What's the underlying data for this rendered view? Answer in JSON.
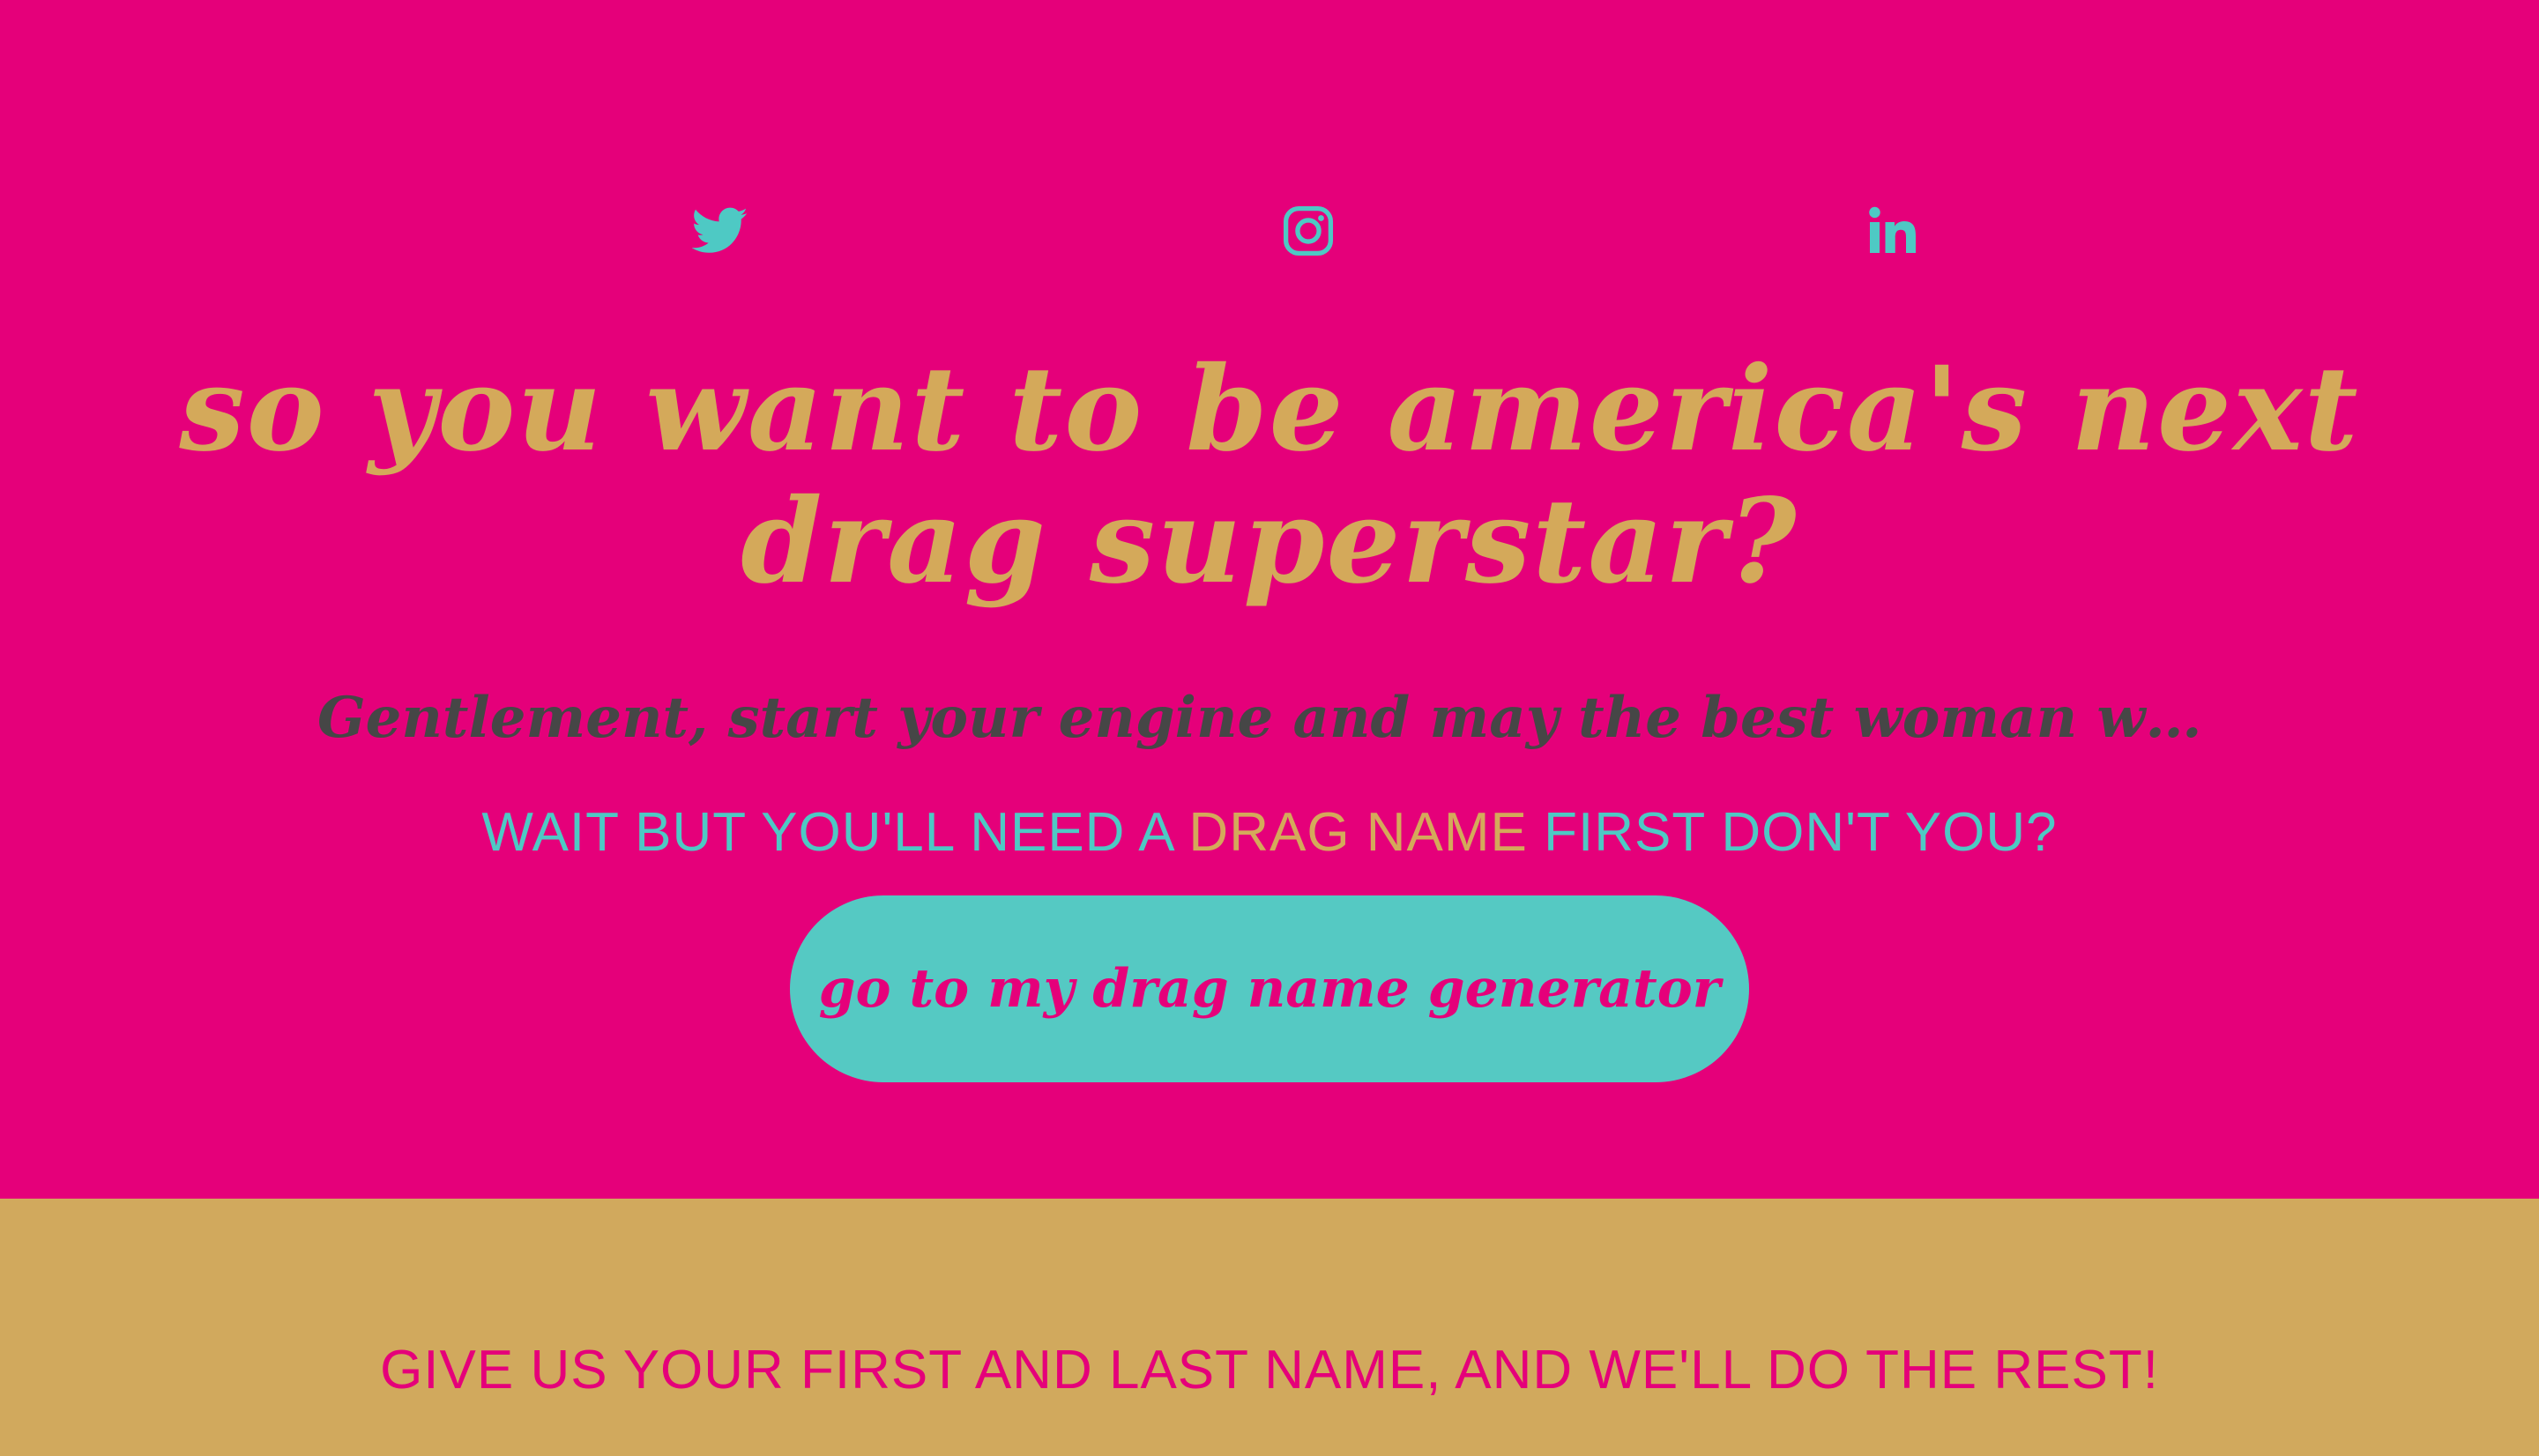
{
  "social": {
    "twitter_icon": "twitter-icon",
    "instagram_icon": "instagram-icon",
    "linkedin_icon": "linkedin-icon"
  },
  "hero": {
    "title": "So you want to be America's next drag superstar?",
    "subtitle": "Gentlement, start your engine and may the best woman wi...",
    "prompt_part1": "WAIT BUT YOU'LL NEED A ",
    "prompt_highlight": "DRAG NAME",
    "prompt_part2": " FIRST DON'T YOU?",
    "cta_label": "go to my drag name generator"
  },
  "band": {
    "text": "GIVE US YOUR FIRST AND LAST NAME, AND WE'LL DO THE REST!"
  },
  "colors": {
    "background": "#e5007a",
    "gold": "#d4a95a",
    "teal": "#4ec9c4",
    "band": "#d1a95d",
    "subtitle": "#464646"
  }
}
